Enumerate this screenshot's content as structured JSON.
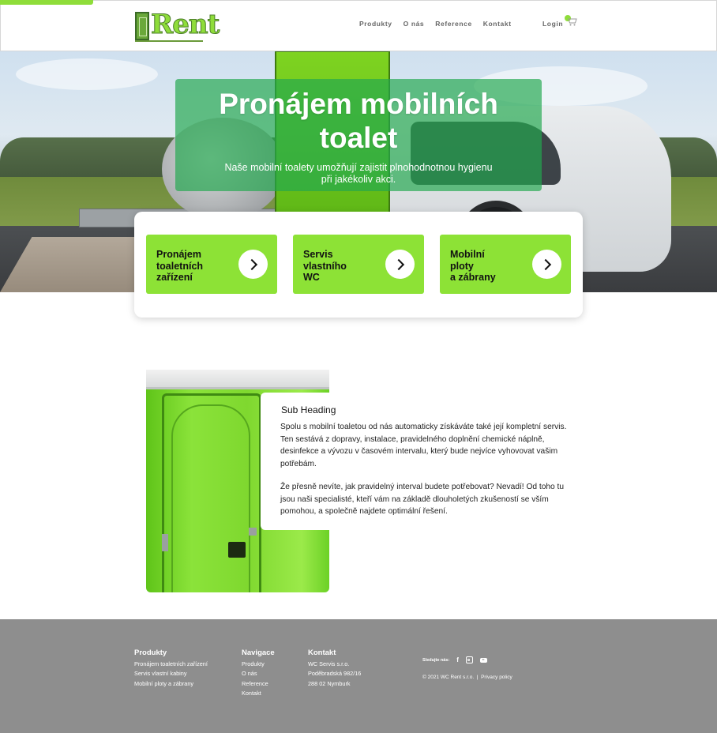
{
  "brand": {
    "logo_text": "Rent",
    "accent": "#8de236",
    "dark_green": "#22a84e",
    "footer_bg": "#8e8e8e"
  },
  "nav": {
    "items": [
      "Produkty",
      "O nás",
      "Reference",
      "Kontakt"
    ],
    "login": "Login",
    "cart_icon": "cart-icon"
  },
  "hero": {
    "title_line1": "Pronájem mobilních",
    "title_line2": "toalet",
    "subtitle": "Naše mobilní toalety umožňují zajistit plnohodnotnou hygienu při jakékoliv akci."
  },
  "services": [
    {
      "line1": "Pronájem",
      "line2": "toaletních",
      "line3": "zařízení"
    },
    {
      "line1": "Servis",
      "line2": "vlastního",
      "line3": "WC"
    },
    {
      "line1": "Mobilní",
      "line2": "ploty",
      "line3": "a zábrany"
    }
  ],
  "content": {
    "sub_heading": "Sub Heading",
    "paragraph1": "Spolu s mobilní toaletou od nás automaticky získáváte také její kompletní servis. Ten sestává z dopravy, instalace, pravidelného doplnění chemické náplně, desinfekce a vývozu v časovém intervalu, který bude nejvíce vyhovovat vašim potřebám.",
    "paragraph2": "Že přesně nevíte, jak pravidelný interval budete potřebovat? Nevadí! Od toho tu jsou naši specialisté, kteří vám na základě dlouholetých zkušeností se vším pomohou, a společně najdete optimální řešení."
  },
  "footer": {
    "produkty": {
      "heading": "Produkty",
      "items": [
        "Pronájem toaletních zařízení",
        "Servis vlastní kabiny",
        "Mobilní ploty a zábrany"
      ]
    },
    "navigace": {
      "heading": "Navigace",
      "items": [
        "Produkty",
        "O nás",
        "Reference",
        "Kontakt"
      ]
    },
    "kontakt": {
      "heading": "Kontakt",
      "items": [
        "WC Servis s.r.o.",
        "Poděbradská 982/16",
        "288 02 Nymburk"
      ]
    },
    "follow_label": "Sledujte nás:",
    "social_icons": [
      "facebook-icon",
      "instagram-icon",
      "youtube-icon"
    ],
    "copyright": "© 2021 WC Rent s.r.o.",
    "separator": "|",
    "privacy": "Privacy policy"
  }
}
